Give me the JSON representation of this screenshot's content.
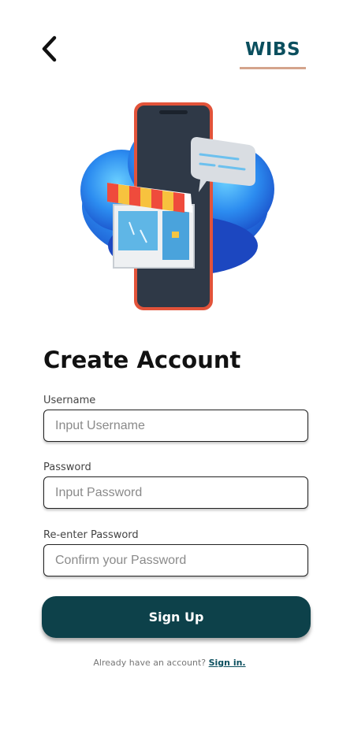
{
  "header": {
    "brand": "WIBS",
    "back_icon": "chevron-left-icon",
    "accent_color": "#0b4f5e",
    "underline_color": "#d4a48c"
  },
  "hero": {
    "illustration": "phone-storefront-chat-illustration"
  },
  "form": {
    "title": "Create Account",
    "username": {
      "label": "Username",
      "placeholder": "Input Username",
      "value": ""
    },
    "password": {
      "label": "Password",
      "placeholder": "Input Password",
      "value": ""
    },
    "confirm": {
      "label": "Re-enter Password",
      "placeholder": "Confirm your Password",
      "value": ""
    },
    "submit_label": "Sign Up",
    "button_color": "#0d414a"
  },
  "footer": {
    "prompt": "Already have an account?",
    "link_label": "Sign in."
  }
}
